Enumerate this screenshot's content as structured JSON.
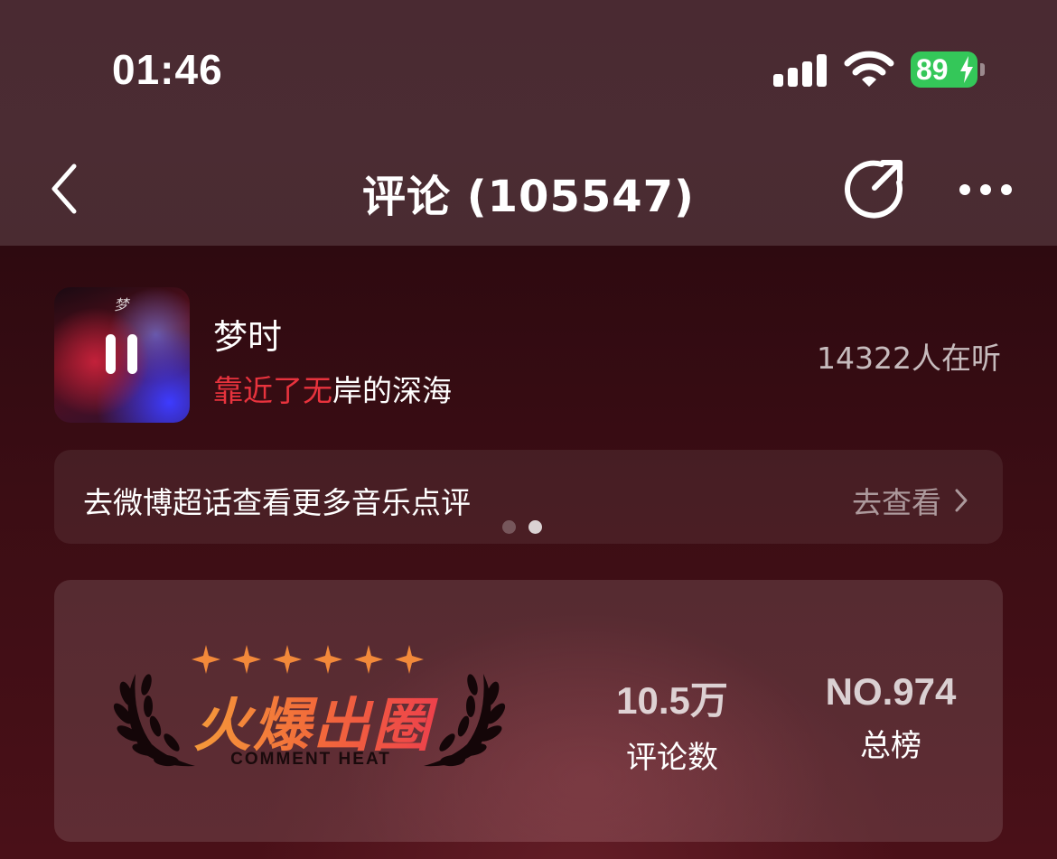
{
  "status_bar": {
    "time": "01:46",
    "battery": "89"
  },
  "nav": {
    "title": "评论 (105547)"
  },
  "song": {
    "cover_text": "梦",
    "title": "梦时",
    "lyric_highlight": "靠近了无",
    "lyric_rest": "岸的深海",
    "listeners": "14322人在听"
  },
  "banner": {
    "text": "去微博超话查看更多音乐点评",
    "link_label": "去查看",
    "page_dots": 2,
    "active_dot": 2
  },
  "heat": {
    "title": "火爆出圈",
    "subtitle": "COMMENT HEAT",
    "star_count": 6,
    "comment_count": "10.5万",
    "comment_label": "评论数",
    "rank": "NO.974",
    "rank_label": "总榜"
  },
  "colors": {
    "accent_red": "#e8333d",
    "battery_green": "#34c759",
    "star_orange": "#f2893a"
  }
}
